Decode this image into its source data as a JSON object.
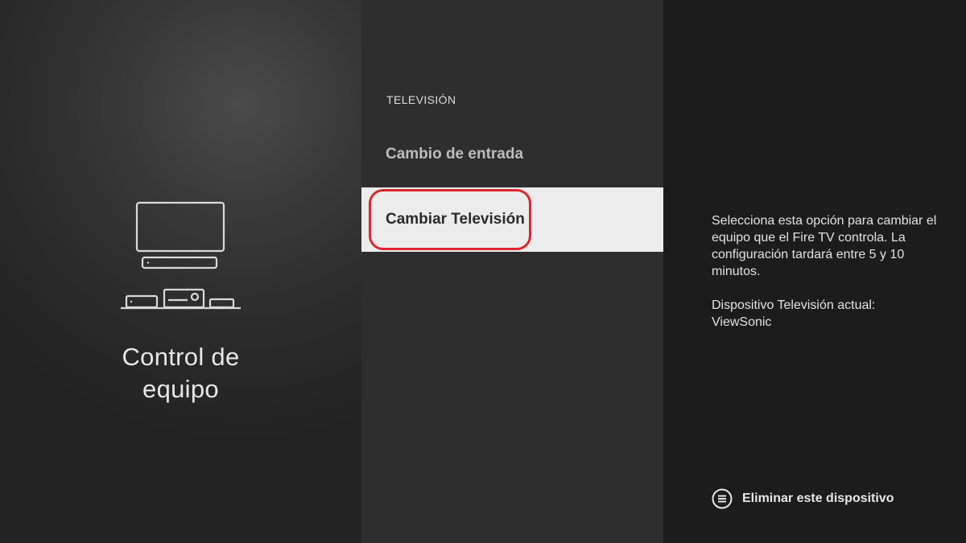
{
  "left": {
    "title_line1": "Control de",
    "title_line2": "equipo",
    "illustration_icon": "tv-and-devices-icon"
  },
  "menu": {
    "category": "TELEVISIÓN",
    "items": [
      {
        "label": "Cambio de entrada",
        "selected": false
      },
      {
        "label": "Cambiar Televisión",
        "selected": true
      }
    ]
  },
  "details": {
    "description": "Selecciona esta opción para cambiar el equipo que el Fire TV controla. La configuración tardará entre 5 y 10 minutos.",
    "current_device_label": "Dispositivo Televisión actual:",
    "current_device_value": "ViewSonic"
  },
  "action": {
    "icon": "menu-button-icon",
    "label": "Eliminar este dispositivo"
  },
  "colors": {
    "highlight_ring": "#e0242d",
    "selected_bg": "#ececec"
  }
}
